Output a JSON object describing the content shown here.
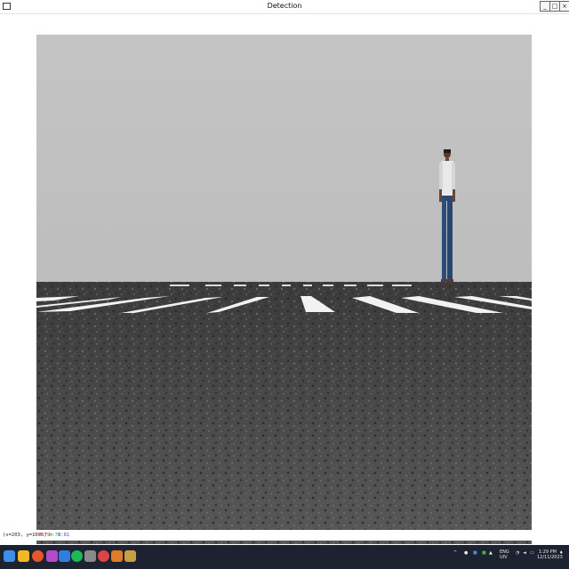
{
  "window": {
    "title": "Detection"
  },
  "status": {
    "coords": "(x=203, y=1076) ~",
    "r": "R:79",
    "g": "G:77",
    "b": "B:81",
    "colors": {
      "r": "#d43a3a",
      "g": "#3aa84a",
      "b": "#3a5fd4"
    }
  },
  "taskbar": {
    "icons": [
      "windows-start-icon",
      "file-explorer-icon",
      "firefox-icon",
      "colorful-app-icon",
      "checkmark-app-icon",
      "spotify-icon",
      "editor-icon",
      "clock-app-icon",
      "matlab-icon",
      "settings-app-icon"
    ],
    "tray": {
      "lang_top": "ENG",
      "lang_bottom": "UIV",
      "time": "1:29 PM",
      "date": "12/11/2023"
    }
  }
}
